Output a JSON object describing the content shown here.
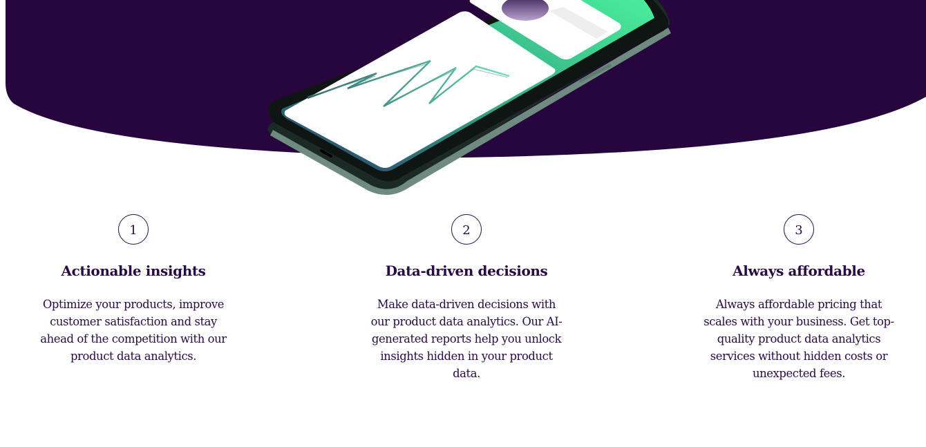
{
  "colors": {
    "hero_background": "#26063c",
    "accent_green": "#44f29c",
    "text": "#2a0a44"
  },
  "hero": {
    "illustration": "smartphone-with-analytics-chart"
  },
  "features": [
    {
      "number": "1",
      "title": "Actionable insights",
      "description": "Optimize your products, improve customer satisfaction and stay ahead of the competition with our product data analytics."
    },
    {
      "number": "2",
      "title": "Data-driven decisions",
      "description": "Make data-driven decisions with our product data analytics. Our AI-generated reports help you unlock insights hidden in your product data."
    },
    {
      "number": "3",
      "title": "Always affordable",
      "description": "Always affordable pricing that scales with your business. Get top-quality product data analytics services without hidden costs or unexpected fees."
    }
  ]
}
